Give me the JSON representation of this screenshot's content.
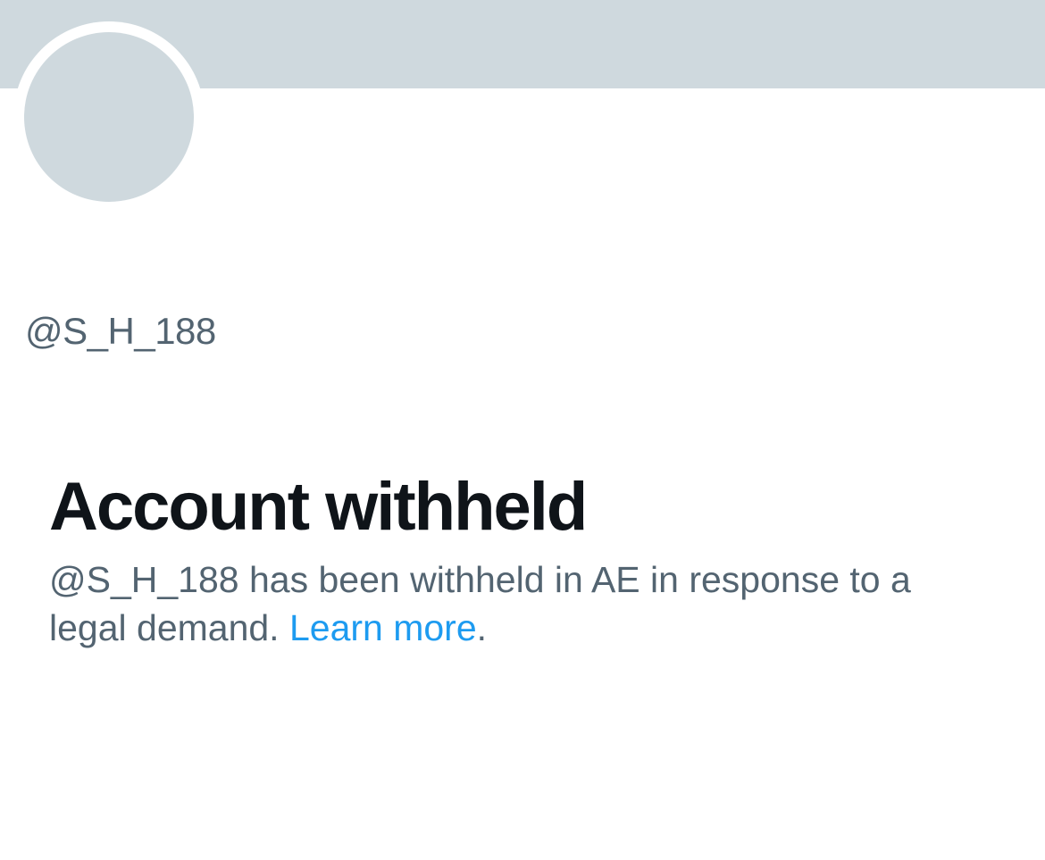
{
  "profile": {
    "handle": "@S_H_188"
  },
  "withheld": {
    "title": "Account withheld",
    "message_handle": "@S_H_188",
    "message_body": " has been withheld in AE in response to a legal demand. ",
    "link_text": "Learn more",
    "trailing": "."
  },
  "colors": {
    "banner": "#cfd9de",
    "avatar": "#cfd9de",
    "title": "#0f1419",
    "secondary_text": "#536471",
    "link": "#1d9bf0"
  }
}
